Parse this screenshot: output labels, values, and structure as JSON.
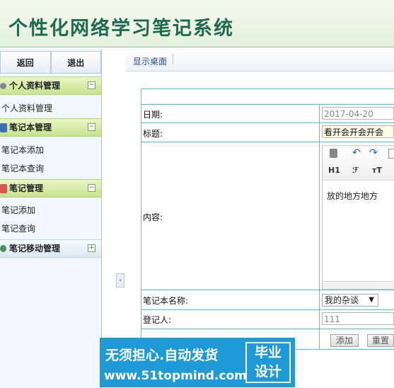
{
  "header": {
    "title": "个性化网络学习笔记系统"
  },
  "sidebar": {
    "back_label": "返回",
    "exit_label": "退出",
    "groups": [
      {
        "label": "个人资料管理",
        "toggle": "−",
        "items": [
          "个人资料管理"
        ]
      },
      {
        "label": "笔记本管理",
        "toggle": "−",
        "items": [
          "笔记本添加",
          "笔记本查询"
        ]
      },
      {
        "label": "笔记管理",
        "toggle": "−",
        "items": [
          "笔记添加",
          "笔记查询"
        ]
      },
      {
        "label": "笔记移动管理",
        "toggle": "+",
        "items": []
      }
    ],
    "collapse_glyph": "‹"
  },
  "crumb": {
    "link": "显示桌面"
  },
  "form": {
    "date_label": "日期:",
    "date_value": "2017-04-20",
    "title_label": "标题:",
    "title_value": "看开会开会开会",
    "content_label": "内容:",
    "content_text": "放的地方地方",
    "toolbar": {
      "h1": "H1",
      "font": "ℱ",
      "size": "тT"
    },
    "notebook_label": "笔记本名称:",
    "notebook_value": "我的杂谈",
    "recorder_label": "登记人:",
    "recorder_value": "111",
    "add_label": "添加",
    "reset_label": "重置"
  },
  "watermark": {
    "line1": "无须担心.自动发货",
    "line2": "www.51topmind.com",
    "box_top": "毕业",
    "box_bottom": "设计"
  }
}
